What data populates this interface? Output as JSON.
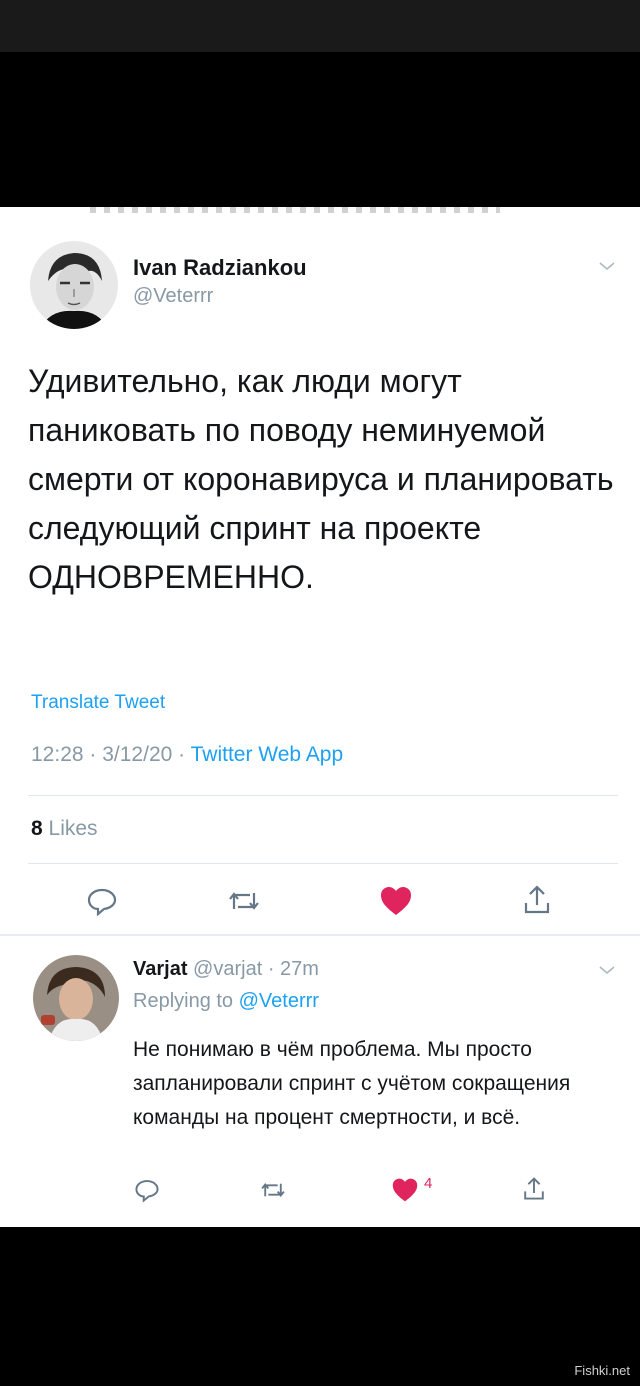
{
  "tweet": {
    "author_name": "Ivan Radziankou",
    "handle": "@Veterrr",
    "text": "Удивительно, как люди могут паниковать по поводу неминуемой смерти от коронавируса и планировать следующий спринт на проекте ОДНОВРЕМЕННО.",
    "translate_label": "Translate Tweet",
    "time": "12:28",
    "date": "3/12/20",
    "source": "Twitter Web App",
    "likes_count": "8",
    "likes_label": "Likes"
  },
  "reply": {
    "author_name": "Varjat",
    "handle": "@varjat",
    "age": "27m",
    "replying_label": "Replying to",
    "replying_to": "@Veterrr",
    "text": "Не понимаю в чём проблема. Мы просто запланировали спринт с учётом сокращения команды на процент смертности, и всё.",
    "like_count": "4"
  },
  "icons": {
    "reply": "reply-icon",
    "retweet": "retweet-icon",
    "like": "heart-icon",
    "share": "share-icon",
    "menu": "chevron-down-icon"
  },
  "colors": {
    "link": "#1da1f2",
    "muted": "#8899a6",
    "like": "#e0245e",
    "text": "#14171a"
  },
  "watermark": "Fishki.net"
}
